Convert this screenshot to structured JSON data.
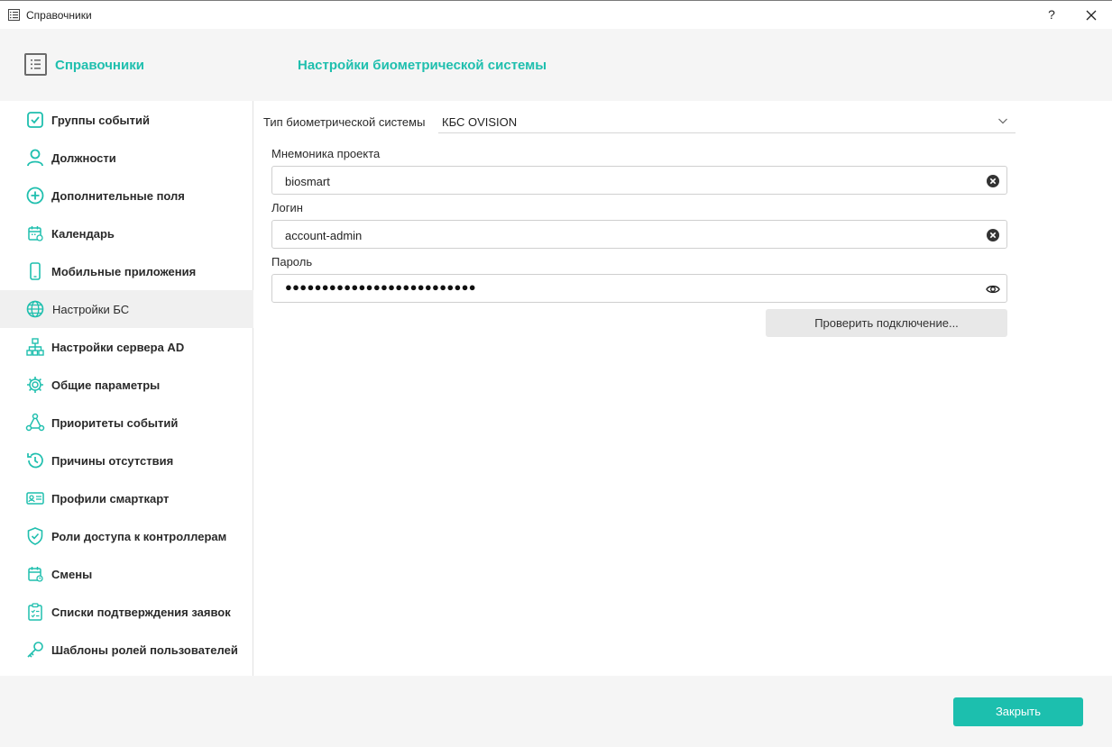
{
  "window": {
    "title": "Справочники",
    "help_label": "?"
  },
  "header": {
    "title": "Справочники",
    "page_title": "Настройки биометрической системы"
  },
  "sidebar": {
    "items": [
      {
        "label": "Группы событий",
        "icon": "checkbox-icon"
      },
      {
        "label": "Должности",
        "icon": "user-icon"
      },
      {
        "label": "Дополнительные поля",
        "icon": "plus-circle-icon"
      },
      {
        "label": "Календарь",
        "icon": "calendar-icon"
      },
      {
        "label": "Мобильные приложения",
        "icon": "mobile-icon"
      },
      {
        "label": "Настройки БС",
        "icon": "globe-icon",
        "active": true
      },
      {
        "label": "Настройки сервера AD",
        "icon": "hierarchy-icon"
      },
      {
        "label": "Общие параметры",
        "icon": "gear-icon"
      },
      {
        "label": "Приоритеты событий",
        "icon": "network-icon"
      },
      {
        "label": "Причины отсутствия",
        "icon": "history-icon"
      },
      {
        "label": "Профили смарткарт",
        "icon": "id-card-icon"
      },
      {
        "label": "Роли доступа к контроллерам",
        "icon": "shield-icon"
      },
      {
        "label": "Смены",
        "icon": "schedule-icon"
      },
      {
        "label": "Списки подтверждения заявок",
        "icon": "clipboard-icon"
      },
      {
        "label": "Шаблоны ролей пользователей",
        "icon": "key-icon"
      }
    ]
  },
  "form": {
    "type_label": "Тип биометрической системы",
    "type_value": "КБС OVISION",
    "mnemonic_label": "Мнемоника проекта",
    "mnemonic_value": "biosmart",
    "login_label": "Логин",
    "login_value": "account-admin",
    "password_label": "Пароль",
    "password_dots": "●●●●●●●●●●●●●●●●●●●●●●●●●●",
    "check_button": "Проверить подключение..."
  },
  "footer": {
    "close_button": "Закрыть"
  },
  "colors": {
    "accent": "#1fbfae",
    "sidebar_active": "#f0f0f0",
    "header_bg": "#f5f5f5"
  }
}
